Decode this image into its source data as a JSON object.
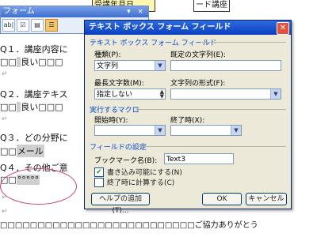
{
  "document": {
    "top_cells": [
      "受講年月日",
      "ード講座"
    ],
    "lines": [
      {
        "q": "Q１．講座内容に"
      },
      {
        "a_boxes": "□□",
        "a_label": "良い",
        "a_rest": "□□□"
      },
      {
        "q": "Q２．講座テキス"
      },
      {
        "a_boxes": "□□",
        "a_label": "良い",
        "a_rest": "□□□"
      },
      {
        "q": "Q３．どの分野に"
      },
      {
        "a_boxes": "□□",
        "a_label": "メール"
      },
      {
        "q": "Q４．その他ご意"
      },
      {
        "a_boxes": "□□",
        "a_label": "°°°°°"
      },
      {
        "footer": "□□□□□□□□□□□□□□□□□□□□□□□□□□ご協力ありがとう"
      }
    ],
    "paragraph_mark": "↵"
  },
  "forms_toolbar": {
    "title": "フォーム",
    "controls": "▾ ×",
    "icons": [
      {
        "name": "text-field-icon",
        "glyph": "ab|"
      },
      {
        "name": "checkbox-field-icon",
        "glyph": "☑"
      },
      {
        "name": "dropdown-field-icon",
        "glyph": "▤"
      },
      {
        "name": "field-options-icon",
        "glyph": "☰"
      }
    ]
  },
  "dialog": {
    "title": "テキスト ボックス フォーム フィールド",
    "close": "✕",
    "section_field": "テキスト ボックス フォーム フィールド",
    "type_label": "種類(P):",
    "type_value": "文字列",
    "default_label": "既定の文字列(E):",
    "default_value": "",
    "maxlen_label": "最長文字数(M):",
    "maxlen_value": "指定しない",
    "format_label": "文字列の形式(F):",
    "format_value": "",
    "section_macro": "実行するマクロ",
    "entry_label": "開始時(Y):",
    "exit_label": "終了時(X):",
    "section_settings": "フィールドの設定",
    "bookmark_label": "ブックマーク名(B):",
    "bookmark_value": "Text3",
    "fill_in_label": "書き込み可能にする(N)",
    "fill_in_checked": true,
    "calc_label": "終了時に計算する(C)",
    "calc_checked": false,
    "help_button": "ヘルプの追加(T)...",
    "ok_button": "OK",
    "cancel_button": "キャンセル"
  }
}
